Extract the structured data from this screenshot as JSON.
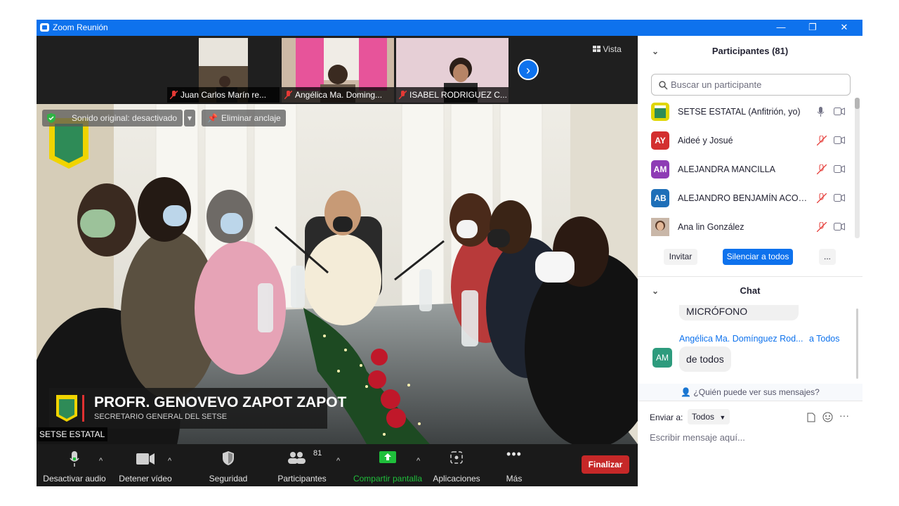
{
  "window": {
    "title": "Zoom Reunión",
    "minimize": "—",
    "restore": "❐",
    "close": "✕"
  },
  "strip": {
    "thumbs": [
      {
        "name": "Juan Carlos Marín re..."
      },
      {
        "name": "Angélica Ma. Doming..."
      },
      {
        "name": "ISABEL RODRIGUEZ C..."
      }
    ],
    "next": "›",
    "vista": "Vista"
  },
  "main": {
    "sound_pill": "Sonido original: desactivado",
    "unpin_pill": "Eliminar anclaje",
    "lower_third_name": "PROFR. GENOVEVO ZAPOT ZAPOT",
    "lower_third_role": "SECRETARIO GENERAL DEL SETSE",
    "speaker_label": "SETSE ESTATAL"
  },
  "toolbar": {
    "mute": "Desactivar audio",
    "video": "Detener vídeo",
    "security": "Seguridad",
    "participants": "Participantes",
    "participants_count": "81",
    "share": "Compartir pantalla",
    "apps": "Aplicaciones",
    "more": "Más",
    "end": "Finalizar"
  },
  "participants_panel": {
    "title": "Participantes (81)",
    "search_placeholder": "Buscar un participante",
    "list": [
      {
        "name": "SETSE ESTATAL (Anfitrión, yo)",
        "initials": "",
        "color": "#e0d600"
      },
      {
        "name": "Aideé y Josué",
        "initials": "AY",
        "color": "#d32f2f"
      },
      {
        "name": "ALEJANDRA MANCILLA",
        "initials": "AM",
        "color": "#8e3cb5"
      },
      {
        "name": "ALEJANDRO BENJAMÍN ACOSTA",
        "initials": "AB",
        "color": "#1e6fb8"
      },
      {
        "name": "Ana lin González",
        "initials": "",
        "color": "#8a5a3c"
      }
    ],
    "invite": "Invitar",
    "mute_all": "Silenciar a todos",
    "more": "..."
  },
  "chat": {
    "title": "Chat",
    "prev_message": "MICRÓFONO",
    "sender": "Angélica Ma. Domínguez Rod...",
    "to": "a Todos",
    "avatar": "AM",
    "message": "de todos",
    "who_can_see": "¿Quién puede ver sus mensajes?",
    "send_to_label": "Enviar a:",
    "send_to_value": "Todos",
    "input_placeholder": "Escribir mensaje aquí..."
  },
  "colors": {
    "accent": "#0e72ed",
    "end": "#c62828",
    "share": "#1fbf3b"
  }
}
